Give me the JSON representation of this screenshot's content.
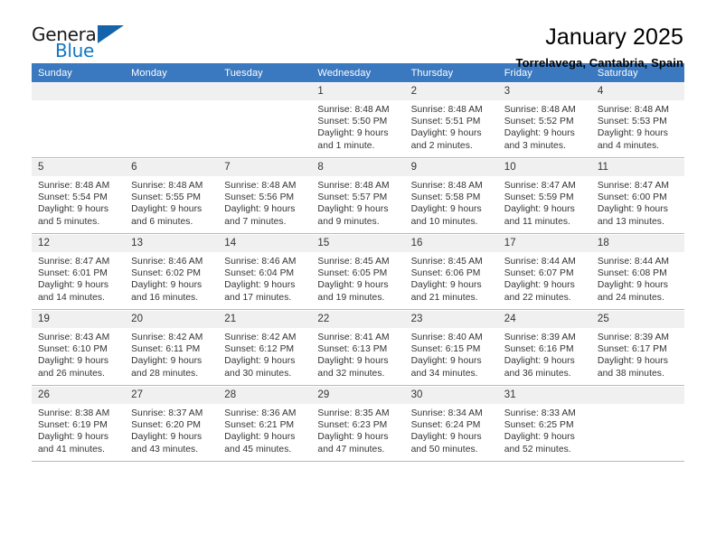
{
  "logo": {
    "word_top": "General",
    "word_bottom": "Blue",
    "triangle_color": "#1464ab",
    "blue_color": "#1277c4"
  },
  "header": {
    "title": "January 2025",
    "subtitle": "Torrelavega, Cantabria, Spain"
  },
  "theme": {
    "header_bg": "#3a78c0",
    "daynum_bg": "#f0f0f0",
    "text": "#333333",
    "rule": "#b9b9b9"
  },
  "weekday_headers": [
    "Sunday",
    "Monday",
    "Tuesday",
    "Wednesday",
    "Thursday",
    "Friday",
    "Saturday"
  ],
  "weeks": [
    [
      {
        "day": "",
        "lines": []
      },
      {
        "day": "",
        "lines": []
      },
      {
        "day": "",
        "lines": []
      },
      {
        "day": "1",
        "lines": [
          "Sunrise: 8:48 AM",
          "Sunset: 5:50 PM",
          "Daylight: 9 hours",
          "and 1 minute."
        ]
      },
      {
        "day": "2",
        "lines": [
          "Sunrise: 8:48 AM",
          "Sunset: 5:51 PM",
          "Daylight: 9 hours",
          "and 2 minutes."
        ]
      },
      {
        "day": "3",
        "lines": [
          "Sunrise: 8:48 AM",
          "Sunset: 5:52 PM",
          "Daylight: 9 hours",
          "and 3 minutes."
        ]
      },
      {
        "day": "4",
        "lines": [
          "Sunrise: 8:48 AM",
          "Sunset: 5:53 PM",
          "Daylight: 9 hours",
          "and 4 minutes."
        ]
      }
    ],
    [
      {
        "day": "5",
        "lines": [
          "Sunrise: 8:48 AM",
          "Sunset: 5:54 PM",
          "Daylight: 9 hours",
          "and 5 minutes."
        ]
      },
      {
        "day": "6",
        "lines": [
          "Sunrise: 8:48 AM",
          "Sunset: 5:55 PM",
          "Daylight: 9 hours",
          "and 6 minutes."
        ]
      },
      {
        "day": "7",
        "lines": [
          "Sunrise: 8:48 AM",
          "Sunset: 5:56 PM",
          "Daylight: 9 hours",
          "and 7 minutes."
        ]
      },
      {
        "day": "8",
        "lines": [
          "Sunrise: 8:48 AM",
          "Sunset: 5:57 PM",
          "Daylight: 9 hours",
          "and 9 minutes."
        ]
      },
      {
        "day": "9",
        "lines": [
          "Sunrise: 8:48 AM",
          "Sunset: 5:58 PM",
          "Daylight: 9 hours",
          "and 10 minutes."
        ]
      },
      {
        "day": "10",
        "lines": [
          "Sunrise: 8:47 AM",
          "Sunset: 5:59 PM",
          "Daylight: 9 hours",
          "and 11 minutes."
        ]
      },
      {
        "day": "11",
        "lines": [
          "Sunrise: 8:47 AM",
          "Sunset: 6:00 PM",
          "Daylight: 9 hours",
          "and 13 minutes."
        ]
      }
    ],
    [
      {
        "day": "12",
        "lines": [
          "Sunrise: 8:47 AM",
          "Sunset: 6:01 PM",
          "Daylight: 9 hours",
          "and 14 minutes."
        ]
      },
      {
        "day": "13",
        "lines": [
          "Sunrise: 8:46 AM",
          "Sunset: 6:02 PM",
          "Daylight: 9 hours",
          "and 16 minutes."
        ]
      },
      {
        "day": "14",
        "lines": [
          "Sunrise: 8:46 AM",
          "Sunset: 6:04 PM",
          "Daylight: 9 hours",
          "and 17 minutes."
        ]
      },
      {
        "day": "15",
        "lines": [
          "Sunrise: 8:45 AM",
          "Sunset: 6:05 PM",
          "Daylight: 9 hours",
          "and 19 minutes."
        ]
      },
      {
        "day": "16",
        "lines": [
          "Sunrise: 8:45 AM",
          "Sunset: 6:06 PM",
          "Daylight: 9 hours",
          "and 21 minutes."
        ]
      },
      {
        "day": "17",
        "lines": [
          "Sunrise: 8:44 AM",
          "Sunset: 6:07 PM",
          "Daylight: 9 hours",
          "and 22 minutes."
        ]
      },
      {
        "day": "18",
        "lines": [
          "Sunrise: 8:44 AM",
          "Sunset: 6:08 PM",
          "Daylight: 9 hours",
          "and 24 minutes."
        ]
      }
    ],
    [
      {
        "day": "19",
        "lines": [
          "Sunrise: 8:43 AM",
          "Sunset: 6:10 PM",
          "Daylight: 9 hours",
          "and 26 minutes."
        ]
      },
      {
        "day": "20",
        "lines": [
          "Sunrise: 8:42 AM",
          "Sunset: 6:11 PM",
          "Daylight: 9 hours",
          "and 28 minutes."
        ]
      },
      {
        "day": "21",
        "lines": [
          "Sunrise: 8:42 AM",
          "Sunset: 6:12 PM",
          "Daylight: 9 hours",
          "and 30 minutes."
        ]
      },
      {
        "day": "22",
        "lines": [
          "Sunrise: 8:41 AM",
          "Sunset: 6:13 PM",
          "Daylight: 9 hours",
          "and 32 minutes."
        ]
      },
      {
        "day": "23",
        "lines": [
          "Sunrise: 8:40 AM",
          "Sunset: 6:15 PM",
          "Daylight: 9 hours",
          "and 34 minutes."
        ]
      },
      {
        "day": "24",
        "lines": [
          "Sunrise: 8:39 AM",
          "Sunset: 6:16 PM",
          "Daylight: 9 hours",
          "and 36 minutes."
        ]
      },
      {
        "day": "25",
        "lines": [
          "Sunrise: 8:39 AM",
          "Sunset: 6:17 PM",
          "Daylight: 9 hours",
          "and 38 minutes."
        ]
      }
    ],
    [
      {
        "day": "26",
        "lines": [
          "Sunrise: 8:38 AM",
          "Sunset: 6:19 PM",
          "Daylight: 9 hours",
          "and 41 minutes."
        ]
      },
      {
        "day": "27",
        "lines": [
          "Sunrise: 8:37 AM",
          "Sunset: 6:20 PM",
          "Daylight: 9 hours",
          "and 43 minutes."
        ]
      },
      {
        "day": "28",
        "lines": [
          "Sunrise: 8:36 AM",
          "Sunset: 6:21 PM",
          "Daylight: 9 hours",
          "and 45 minutes."
        ]
      },
      {
        "day": "29",
        "lines": [
          "Sunrise: 8:35 AM",
          "Sunset: 6:23 PM",
          "Daylight: 9 hours",
          "and 47 minutes."
        ]
      },
      {
        "day": "30",
        "lines": [
          "Sunrise: 8:34 AM",
          "Sunset: 6:24 PM",
          "Daylight: 9 hours",
          "and 50 minutes."
        ]
      },
      {
        "day": "31",
        "lines": [
          "Sunrise: 8:33 AM",
          "Sunset: 6:25 PM",
          "Daylight: 9 hours",
          "and 52 minutes."
        ]
      },
      {
        "day": "",
        "lines": []
      }
    ]
  ]
}
